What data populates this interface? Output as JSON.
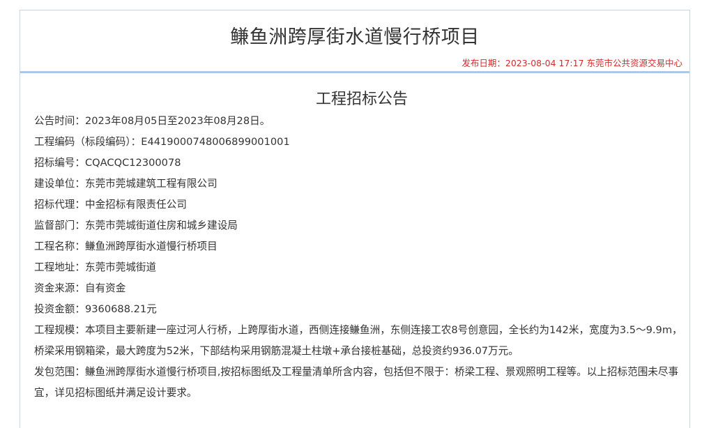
{
  "header": {
    "title": "鳒鱼洲跨厚街水道慢行桥项目",
    "meta": "发布日期：2023-08-04 17:17 东莞市公共资源交易中心"
  },
  "notice": {
    "title": "工程招标公告",
    "rows": [
      {
        "label": "公告时间：",
        "value": "2023年08月05日至2023年08月28日。"
      },
      {
        "label": "工程编码（标段编码）：",
        "value": "E4419000748006899001001"
      },
      {
        "label": "招标编号：",
        "value": "CQACQC12300078"
      },
      {
        "label": "建设单位：",
        "value": "东莞市莞城建筑工程有限公司"
      },
      {
        "label": "招标代理：",
        "value": "中金招标有限责任公司"
      },
      {
        "label": "监督部门：",
        "value": "东莞市莞城街道住房和城乡建设局"
      },
      {
        "label": "工程名称：",
        "value": "鳒鱼洲跨厚街水道慢行桥项目"
      },
      {
        "label": "工程地址：",
        "value": "东莞市莞城街道"
      },
      {
        "label": "资金来源：",
        "value": "自有资金"
      },
      {
        "label": "投资金额：",
        "value": "9360688.21元"
      },
      {
        "label": "工程规模：",
        "value": "本项目主要新建一座过河人行桥，上跨厚街水道，西侧连接鳒鱼洲，东侧连接工农8号创意园，全长约为142米，宽度为3.5～9.9m，桥梁采用钢箱梁，最大跨度为52米，下部结构采用钢筋混凝土柱墩+承台接桩基础，总投资约936.07万元。"
      },
      {
        "label": "发包范围：",
        "value": "鳒鱼洲跨厚街水道慢行桥项目,按招标图纸及工程量清单所含内容，包括但不限于：桥梁工程、景观照明工程等。以上招标范围未尽事宜，详见招标图纸并满足设计要求。"
      }
    ]
  }
}
